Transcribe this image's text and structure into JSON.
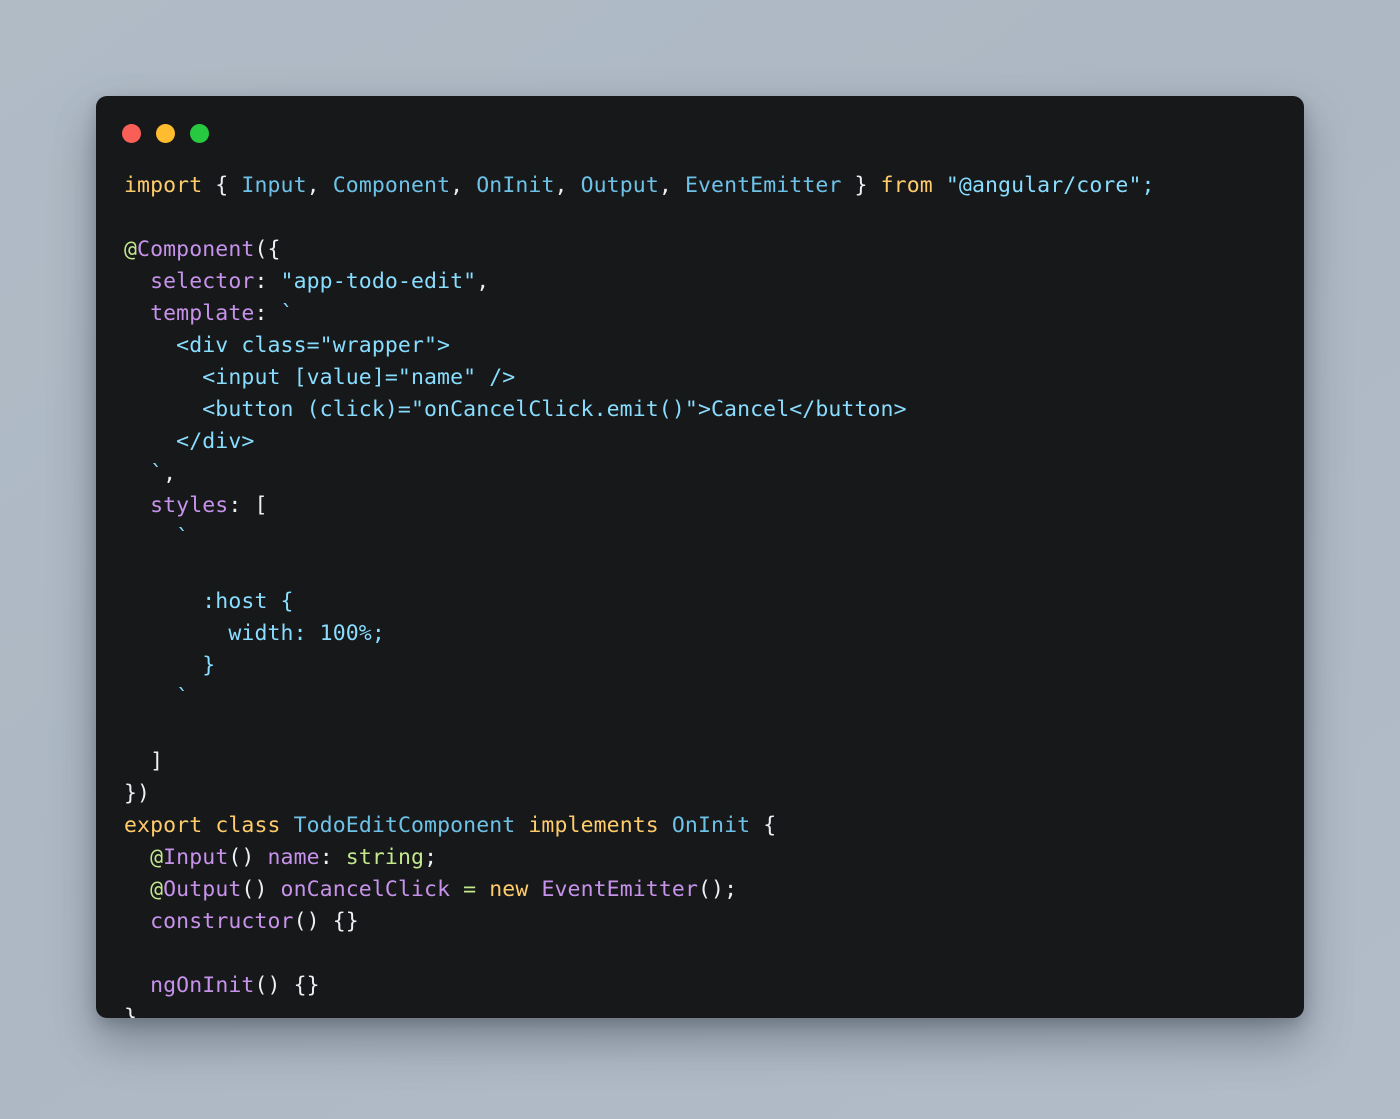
{
  "window": {
    "background_color": "#16181a",
    "page_background_color": "#aeb9c5",
    "traffic_lights": [
      {
        "name": "close",
        "color": "#fa5f57"
      },
      {
        "name": "minimize",
        "color": "#febc2e"
      },
      {
        "name": "zoom",
        "color": "#26c93f"
      }
    ]
  },
  "theme": {
    "keyword": "#ffcb6b",
    "type": "#6ec2e8",
    "punctuation": "#eceff4",
    "property": "#c792ea",
    "string": "#89ddff",
    "operator": "#c3e88d"
  },
  "code": {
    "language": "typescript",
    "filename_hint": "todo-edit.component.ts",
    "lines": [
      "import { Input, Component, OnInit, Output, EventEmitter } from \"@angular/core\";",
      "",
      "@Component({",
      "  selector: \"app-todo-edit\",",
      "  template: `",
      "    <div class=\"wrapper\">",
      "      <input [value]=\"name\" />",
      "      <button (click)=\"onCancelClick.emit()\">Cancel</button>",
      "    </div>",
      "  `,",
      "  styles: [",
      "    `",
      "",
      "      :host {",
      "        width: 100%;",
      "      }",
      "    `",
      "",
      "  ]",
      "})",
      "export class TodoEditComponent implements OnInit {",
      "  @Input() name: string;",
      "  @Output() onCancelClick = new EventEmitter();",
      "  constructor() {}",
      "",
      "  ngOnInit() {}",
      "}"
    ],
    "tokens": {
      "l1": {
        "import": "import",
        "open_brace": " { ",
        "input": "Input",
        "c1": ", ",
        "component": "Component",
        "c2": ", ",
        "oninit": "OnInit",
        "c3": ", ",
        "output": "Output",
        "c4": ", ",
        "eventemitter": "EventEmitter",
        "close_brace": " } ",
        "from": "from",
        "module": " \"@angular/core\";"
      },
      "l3": {
        "at": "@",
        "name": "Component",
        "punc": "({"
      },
      "l4": {
        "key": "  selector",
        "colon": ": ",
        "value": "\"app-todo-edit\"",
        "comma": ","
      },
      "l5": {
        "key": "  template",
        "colon": ": ",
        "tick": "`"
      },
      "l6": "    <div class=\"wrapper\">",
      "l7": "      <input [value]=\"name\" />",
      "l8": "      <button (click)=\"onCancelClick.emit()\">Cancel</button>",
      "l9": "    </div>",
      "l10": {
        "tick": "  `",
        "comma": ","
      },
      "l11": {
        "key": "  styles",
        "colon": ": ",
        "bracket": "["
      },
      "l12": "    `",
      "l14": "      :host {",
      "l15": "        width: 100%;",
      "l16": "      }",
      "l17": "    `",
      "l19": "  ]",
      "l20": "})",
      "l21": {
        "export": "export",
        "class": "class",
        "classname": "TodoEditComponent",
        "implements": "implements",
        "iface": "OnInit",
        "brace": "{"
      },
      "l22": {
        "at": "@",
        "dec": "Input",
        "parens": "() ",
        "prop": "name",
        "colon": ": ",
        "type": "string",
        "semi": ";"
      },
      "l23": {
        "at": "@",
        "dec": "Output",
        "parens": "() ",
        "prop": "onCancelClick",
        "eq": "=",
        "new": "new",
        "ctor": "EventEmitter",
        "tail": "();"
      },
      "l24": {
        "name": "constructor",
        "tail": "() {}"
      },
      "l26": {
        "name": "ngOnInit",
        "tail": "() {}"
      },
      "l27": "}"
    }
  }
}
